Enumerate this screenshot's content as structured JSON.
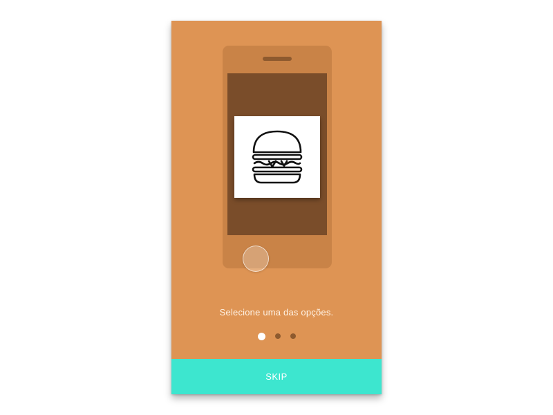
{
  "onboarding": {
    "caption": "Selecione uma das opções.",
    "skip_label": "SKIP",
    "pages": 3,
    "active_page": 1,
    "illustration_icon": "hamburger-icon"
  },
  "colors": {
    "background": "#DE9454",
    "phone_body": "#C98347",
    "phone_screen": "#7A4D2A",
    "skip_bar": "#3DE6CF",
    "dot_active": "#ffffff",
    "dot_inactive": "#8E5A2E"
  }
}
